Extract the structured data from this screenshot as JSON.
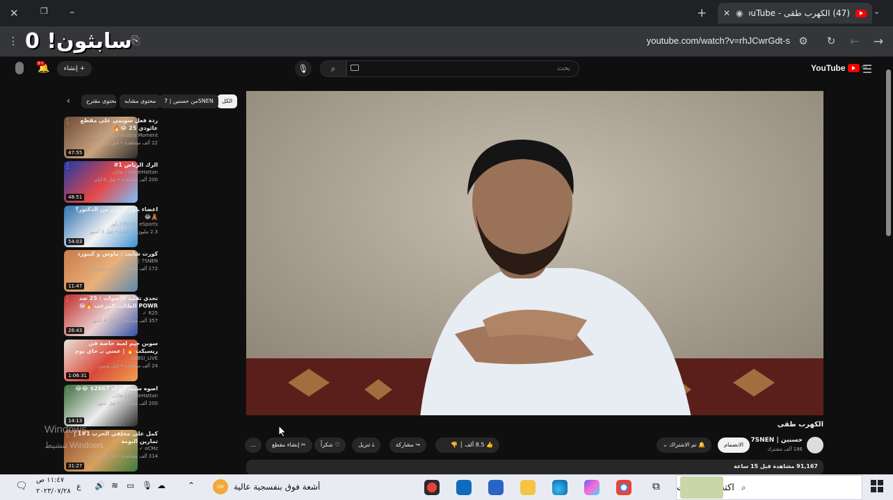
{
  "browser": {
    "tab_title": "(47) الكهرب طقى - YouTube",
    "url": "youtube.com/watch?v=rhJCwrGdt-s",
    "overlay_title": "سابثون! 0"
  },
  "youtube": {
    "logo_text": "YouTube",
    "logo_region": "SA",
    "search_placeholder": "بحث",
    "create_label": "إنشاء",
    "notif_count": "9+"
  },
  "chips": [
    "الكل",
    "من حسنين | 7SNEN",
    "محتوى مشابه",
    "محتوى مقترح"
  ],
  "sidebar_videos": [
    {
      "title": "ردة فعل سويمي على مقطع عائودي 25 😂🔥",
      "channel": "Arabia Moment / شكات العرب",
      "meta": "22 ألف مشاهدة • قبل شهر واحد",
      "duration": "47:55",
      "colors": [
        "#6b4a35",
        "#c9a27e",
        "#2d2d2d"
      ]
    },
    {
      "title": "الرك الرياض 1#",
      "channel": "UncleHattan | هاتان",
      "meta": "200 ألف مشاهدة • قبل 6 أيام",
      "duration": "48:51",
      "colors": [
        "#1e3aa8",
        "#e54848",
        "#79c2ff"
      ]
    },
    {
      "title": "اعضاء باور يخلون من الدكتور؟ 🧸😂",
      "channel": "POWR eSports | باور",
      "meta": "2.3 مليون مشاهدة • قبل 3 أشهر",
      "duration": "54:03",
      "colors": [
        "#2a6fb0",
        "#f2f2f2",
        "#3a8fd1"
      ]
    },
    {
      "title": "كورت شايت : ماوس و كيبورد",
      "channel": "7SNEN | حسنين",
      "meta": "172 ألف مشاهدة • قبل يوم واحد",
      "duration": "11:47",
      "colors": [
        "#c87a4a",
        "#e9b07a",
        "#5a8ab0"
      ]
    },
    {
      "title": "تحدي تقليد الأصوات : 25 ضد POWR الطالب المرعب 🔥😂",
      "channel": "R25 ✓",
      "meta": "357 ألف مشاهدة • قبل 4 أشهر",
      "duration": "26:43",
      "colors": [
        "#c22a2a",
        "#e8d0d0",
        "#3050a0"
      ]
    },
    {
      "title": "سوين جيم لعبة خاصة في ريسبكت 🔥 | عسي بـ حاي يوم",
      "channel": "3ABSI_LIVE",
      "meta": "24 ألف مشاهدة • قبل يومين",
      "duration": "1:06:31",
      "colors": [
        "#e9e2d8",
        "#d84a3a",
        "#f0a050"
      ]
    },
    {
      "title": "اصوه سيت اب له 2667$ 😂😂",
      "channel": "UncleHattan | هاتان",
      "meta": "200 ألف مشاهدة • قبل شهر",
      "duration": "14:13",
      "colors": [
        "#3a6a3a",
        "#eeeeee",
        "#2b2b2b"
      ]
    },
    {
      "title": "كمل على مخلفي الحرب 1#1 | تمارين البومة",
      "channel": "oCMz ✓",
      "meta": "314 ألف مشاهدة • قبل 18 ساعة",
      "duration": "31:27",
      "colors": [
        "#8a4a2a",
        "#d8a060",
        "#3a7a3a"
      ]
    }
  ],
  "video": {
    "title": "الكهرب طقى",
    "channel": "حسنين | 7SNEN",
    "subscribers": "186 ألف مشترك",
    "join_label": "الانضمام",
    "subscribed_label": "تم الاشتراك",
    "likes": "8.5 ألف",
    "share_label": "مشاركة",
    "download_label": "تنزيل",
    "thanks_label": "شكراً",
    "clip_label": "إنشاء مقطع",
    "more_label": "...",
    "views_meta": "91,167 مشاهدة قبل 15 ساعة"
  },
  "windows_watermark": {
    "line1": "Windows",
    "line2": "تنشيط Windows"
  },
  "taskbar": {
    "search_placeholder": "اكتب هنا للبحث",
    "weather_text": "أشعة فوق بنفسجية عالية",
    "weather_badge": "UV",
    "time": "١١:٤٧ ص",
    "date": "٢٠٢٣/٠٧/٢٨",
    "lang": "ع"
  }
}
